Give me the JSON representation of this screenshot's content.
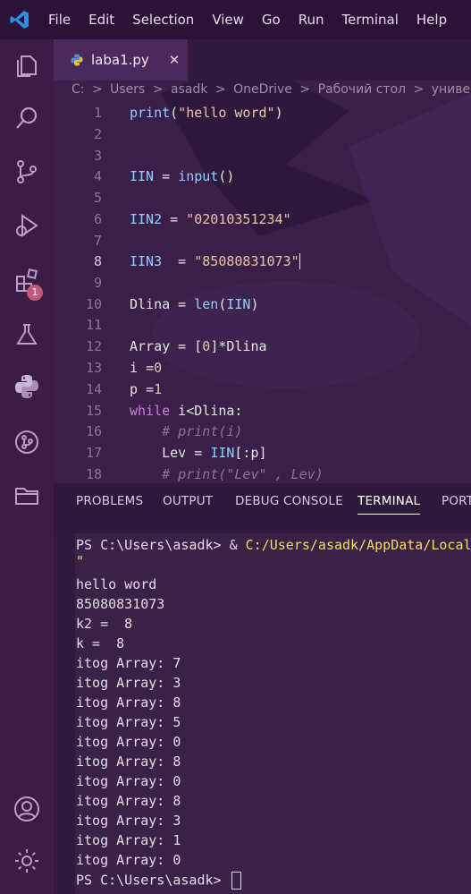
{
  "menu": [
    "File",
    "Edit",
    "Selection",
    "View",
    "Go",
    "Run",
    "Terminal",
    "Help"
  ],
  "activity_bar": {
    "items": [
      "explorer-icon",
      "search-icon",
      "source-control-icon",
      "run-debug-icon",
      "extensions-icon",
      "testing-icon",
      "python-icon",
      "git-graph-icon",
      "folder-icon",
      "account-icon",
      "settings-gear-icon"
    ],
    "extensions_badge": "1"
  },
  "tab": {
    "label": "laba1.py",
    "close": "✕"
  },
  "breadcrumb": [
    "C:",
    ">",
    "Users",
    ">",
    "asadk",
    ">",
    "OneDrive",
    ">",
    "Рабочий стол",
    ">",
    "университе"
  ],
  "code": {
    "line_numbers": [
      "1",
      "2",
      "3",
      "4",
      "5",
      "6",
      "7",
      "8",
      "9",
      "10",
      "11",
      "12",
      "13",
      "14",
      "15",
      "16",
      "17",
      "18"
    ],
    "active_line": "8",
    "lines": [
      "print(\"hello word\")",
      "",
      "",
      "IIN = input()",
      "",
      "IIN2 = \"02010351234\"",
      "",
      "IIN3  = \"85080831073\"",
      "",
      "Dlina = len(IIN)",
      "",
      "Array = [0]*Dlina",
      "i =0",
      "p =1",
      "while i<Dlina:",
      "    # print(i)",
      "    Lev = IIN[:p]",
      "    # print(\"Lev\" , Lev)"
    ]
  },
  "panel": {
    "tabs": [
      "PROBLEMS",
      "OUTPUT",
      "DEBUG CONSOLE",
      "TERMINAL",
      "PORT"
    ],
    "active_tab": "TERMINAL"
  },
  "terminal": {
    "prompt_line": {
      "prompt": "PS C:\\Users\\asadk> & ",
      "path": "C:/Users/asadk/AppData/Local"
    },
    "continuation": "\"",
    "output": [
      "hello word",
      "85080831073",
      "k2 =  8",
      "k =  8",
      "itog Array: 7",
      "itog Array: 3",
      "itog Array: 8",
      "itog Array: 5",
      "itog Array: 0",
      "itog Array: 8",
      "itog Array: 0",
      "itog Array: 8",
      "itog Array: 3",
      "itog Array: 1",
      "itog Array: 0"
    ],
    "final_prompt": "PS C:\\Users\\asadk> "
  }
}
